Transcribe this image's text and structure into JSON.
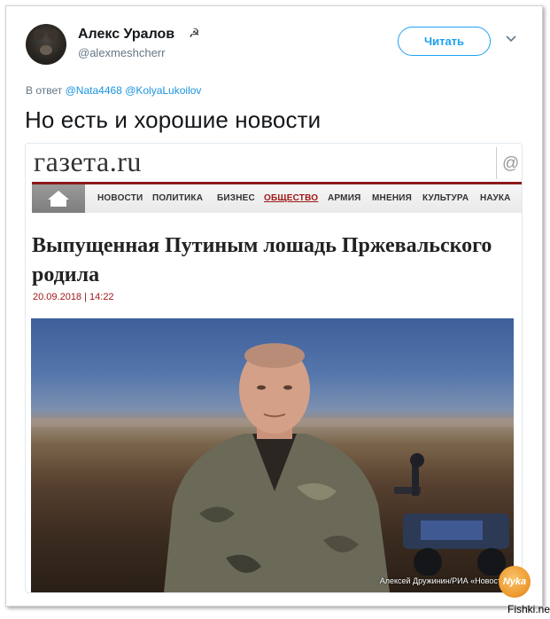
{
  "tweet": {
    "author_name": "Алекс Уралов",
    "author_emoji": "☭",
    "author_handle": "@alexmeshcherr",
    "follow_label": "Читать",
    "reply_prefix": "В ответ",
    "reply_mentions": [
      "@Nata4468",
      "@KolyaLukoilov"
    ],
    "text": "Но есть и хорошие новости"
  },
  "card": {
    "site_logo": "газета.ru",
    "search_icon_glyph": "@",
    "nav_items": [
      {
        "label": "НОВОСТИ",
        "active": false
      },
      {
        "label": "ПОЛИТИКА",
        "active": false
      },
      {
        "label": "БИЗНЕС",
        "active": false
      },
      {
        "label": "ОБЩЕСТВО",
        "active": true
      },
      {
        "label": "АРМИЯ",
        "active": false
      },
      {
        "label": "МНЕНИЯ",
        "active": false
      },
      {
        "label": "КУЛЬТУРА",
        "active": false
      },
      {
        "label": "НАУКА",
        "active": false
      }
    ],
    "headline": "Выпущенная Путиным лошадь Пржевальского родила",
    "dateline": "20.09.2018 | 14:22",
    "photo_credit": "Алексей Дружинин/РИА «Новости»"
  },
  "watermarks": {
    "badge": "Nyka",
    "site": "Fishki.net"
  },
  "colors": {
    "twitter_blue": "#1da1f2",
    "mention_blue": "#1b95e0",
    "gazeta_red": "#a01818",
    "nav_border": "#8b1a1a"
  },
  "icons": {
    "home": "home-icon",
    "caret": "chevron-down-icon",
    "search": "at-sign-icon"
  }
}
